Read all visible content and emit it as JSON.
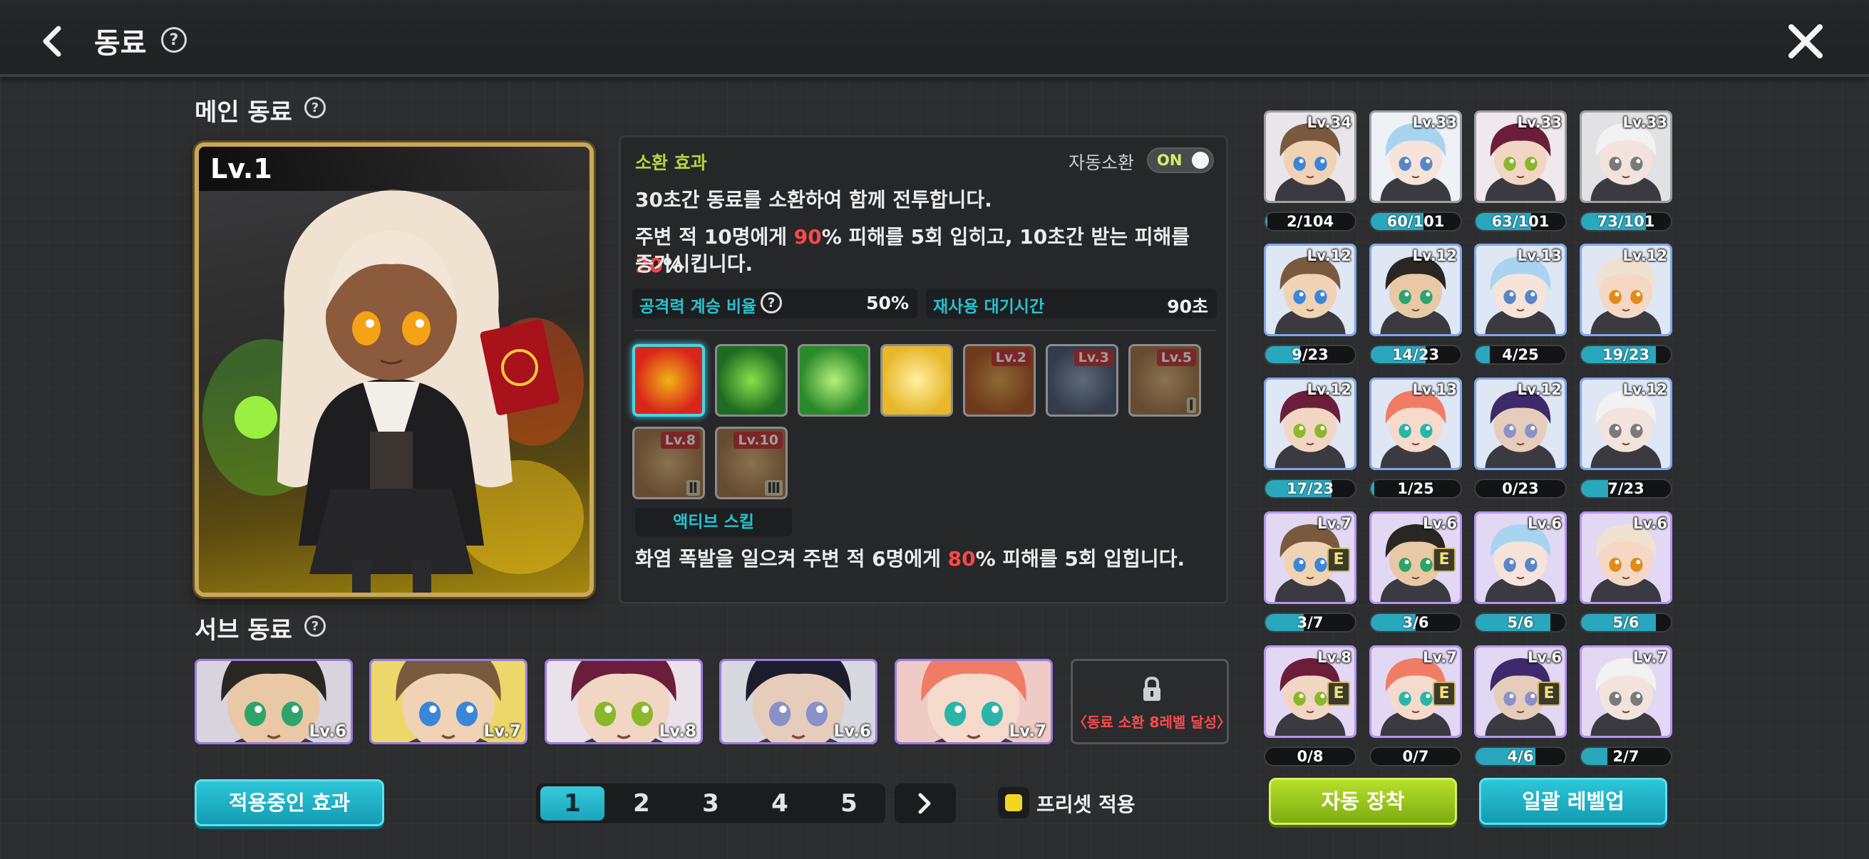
{
  "header": {
    "title": "동료",
    "help_glyph": "?"
  },
  "main_section": {
    "title": "메인 동료",
    "help_glyph": "?",
    "card_level": "Lv.1"
  },
  "skill": {
    "summon_label": "소환 효과",
    "auto_summon_label": "자동소환",
    "auto_summon_state": "ON",
    "desc1": "30초간 동료를 소환하여 함께 전투합니다.",
    "desc2": {
      "a": "주변 적 10명에게 ",
      "v1": "90",
      "b": "% 피해를 5회 입히고, 10초간 받는 피해를 ",
      "v2": "20",
      "c": "%"
    },
    "desc3": "증가시킵니다.",
    "attack_ratio_label": "공격력 계승 비율",
    "attack_ratio_value": "50%",
    "cooldown_label": "재사용 대기시간",
    "cooldown_value": "90초",
    "icons": [
      {
        "name": "skill-fire-burst-icon",
        "level": "",
        "tier": "",
        "selected": true,
        "locked": false,
        "c1": "#d8261a",
        "c2": "#f2b316"
      },
      {
        "name": "skill-green-flame-icon",
        "level": "",
        "tier": "",
        "selected": false,
        "locked": false,
        "c1": "#1e6b22",
        "c2": "#8ae04a"
      },
      {
        "name": "skill-green-sigil-icon",
        "level": "",
        "tier": "",
        "selected": false,
        "locked": false,
        "c1": "#2a8a2a",
        "c2": "#b7f07a"
      },
      {
        "name": "skill-golden-summon-icon",
        "level": "",
        "tier": "",
        "selected": false,
        "locked": false,
        "c1": "#e8b82c",
        "c2": "#fff0a0"
      },
      {
        "name": "skill-fire-wall-icon",
        "level": "Lv.2",
        "tier": "",
        "selected": false,
        "locked": true,
        "c1": "#a84a14",
        "c2": "#e0a040"
      },
      {
        "name": "skill-stance-icon",
        "level": "Lv.3",
        "tier": "",
        "selected": false,
        "locked": true,
        "c1": "#3e4e6a",
        "c2": "#8aa0c0"
      },
      {
        "name": "skill-passive-one-icon",
        "level": "Lv.5",
        "tier": "Ⅰ",
        "selected": false,
        "locked": true,
        "c1": "#9a6a3a",
        "c2": "#d8b070"
      },
      {
        "name": "skill-passive-two-icon",
        "level": "Lv.8",
        "tier": "Ⅱ",
        "selected": false,
        "locked": true,
        "c1": "#9a6a3a",
        "c2": "#d8b070"
      },
      {
        "name": "skill-passive-three-icon",
        "level": "Lv.10",
        "tier": "Ⅲ",
        "selected": false,
        "locked": true,
        "c1": "#9a6a3a",
        "c2": "#d8b070"
      }
    ],
    "active_label": "액티브 스킬",
    "active_desc": {
      "a": "화염 폭발을 일으켜 주변 적 6명에게 ",
      "v": "80",
      "b": "% 피해를 5회 입힙니다."
    }
  },
  "sub_section": {
    "title": "서브 동료",
    "help_glyph": "?",
    "slots": [
      {
        "level": "Lv.6",
        "hair": "#2a2622",
        "skin": "#e9c8a6",
        "eye": "#2ea468",
        "bg": "#d8d4de"
      },
      {
        "level": "Lv.7",
        "hair": "#7a5a3e",
        "skin": "#f0d2b4",
        "eye": "#3a86d8",
        "bg": "#ecd76a"
      },
      {
        "level": "Lv.8",
        "hair": "#6b1e3a",
        "skin": "#f2d6c4",
        "eye": "#8ab82a",
        "bg": "#e9e2ea"
      },
      {
        "level": "Lv.6",
        "hair": "#1c1c2c",
        "skin": "#e6cdbb",
        "eye": "#8a90c8",
        "bg": "#d8d8e0"
      },
      {
        "level": "Lv.7",
        "hair": "#f07c66",
        "skin": "#f6dacb",
        "eye": "#2ab5a8",
        "bg": "#eecbc4"
      }
    ],
    "locked_text": "〈동료 소환 8레벨 달성〉"
  },
  "controls": {
    "applied_effect_btn": "적용중인 효과",
    "pages": [
      "1",
      "2",
      "3",
      "4",
      "5"
    ],
    "active_page": "1",
    "preset_label": "프리셋 적용",
    "auto_equip_btn": "자동 장착",
    "bulk_levelup_btn": "일괄 레벨업"
  },
  "roster": [
    {
      "level": "Lv.34",
      "count": "2/104",
      "progress": 0.02,
      "frame": "gray",
      "badge": "",
      "hair": "#7a5a3e",
      "skin": "#f0d2b4",
      "eye": "#3a86d8",
      "bg": "#e8e6ea"
    },
    {
      "level": "Lv.33",
      "count": "60/101",
      "progress": 0.59,
      "frame": "gray",
      "badge": "",
      "hair": "#a9d4f0",
      "skin": "#f6e4da",
      "eye": "#5a86c8",
      "bg": "#eef2f6"
    },
    {
      "level": "Lv.33",
      "count": "63/101",
      "progress": 0.62,
      "frame": "gray",
      "badge": "",
      "hair": "#6b1e3a",
      "skin": "#f2d6c4",
      "eye": "#8ab82a",
      "bg": "#efe8ec"
    },
    {
      "level": "Lv.33",
      "count": "73/101",
      "progress": 0.72,
      "frame": "gray",
      "badge": "",
      "hair": "#f2f2f2",
      "skin": "#f2e4dc",
      "eye": "#7a7a7a",
      "bg": "#e2e2e4"
    },
    {
      "level": "Lv.12",
      "count": "9/23",
      "progress": 0.39,
      "frame": "blue",
      "badge": "",
      "hair": "#7a5a3e",
      "skin": "#f0d2b4",
      "eye": "#3a86d8",
      "bg": "#dfe6f4"
    },
    {
      "level": "Lv.12",
      "count": "14/23",
      "progress": 0.61,
      "frame": "blue",
      "badge": "",
      "hair": "#2a2622",
      "skin": "#e9c8a6",
      "eye": "#2ea468",
      "bg": "#dfe6f4"
    },
    {
      "level": "Lv.13",
      "count": "4/25",
      "progress": 0.16,
      "frame": "blue",
      "badge": "",
      "hair": "#a9d4f0",
      "skin": "#f6e4da",
      "eye": "#5a86c8",
      "bg": "#dfe6f4"
    },
    {
      "level": "Lv.12",
      "count": "19/23",
      "progress": 0.83,
      "frame": "blue",
      "badge": "",
      "hair": "#efe2d0",
      "skin": "#f4d8c4",
      "eye": "#e28a1a",
      "bg": "#dfe6f4"
    },
    {
      "level": "Lv.12",
      "count": "17/23",
      "progress": 0.74,
      "frame": "blue",
      "badge": "",
      "hair": "#6b1e3a",
      "skin": "#f2d6c4",
      "eye": "#8ab82a",
      "bg": "#dfe6f4"
    },
    {
      "level": "Lv.13",
      "count": "1/25",
      "progress": 0.04,
      "frame": "blue",
      "badge": "",
      "hair": "#f07c66",
      "skin": "#f6dacb",
      "eye": "#2ab5a8",
      "bg": "#dfe6f4"
    },
    {
      "level": "Lv.12",
      "count": "0/23",
      "progress": 0.0,
      "frame": "blue",
      "badge": "",
      "hair": "#3c2a6a",
      "skin": "#e6cdbb",
      "eye": "#8a90c8",
      "bg": "#dfe6f4"
    },
    {
      "level": "Lv.12",
      "count": "7/23",
      "progress": 0.3,
      "frame": "blue",
      "badge": "",
      "hair": "#f2f2f2",
      "skin": "#f2e4dc",
      "eye": "#7a7a7a",
      "bg": "#dfe6f4"
    },
    {
      "level": "Lv.7",
      "count": "3/7",
      "progress": 0.43,
      "frame": "purple",
      "badge": "E",
      "hair": "#7a5a3e",
      "skin": "#f0d2b4",
      "eye": "#3a86d8",
      "bg": "#e2d8f4"
    },
    {
      "level": "Lv.6",
      "count": "3/6",
      "progress": 0.5,
      "frame": "purple",
      "badge": "E",
      "hair": "#2a2622",
      "skin": "#e9c8a6",
      "eye": "#2ea468",
      "bg": "#e2d8f4"
    },
    {
      "level": "Lv.6",
      "count": "5/6",
      "progress": 0.83,
      "frame": "purple",
      "badge": "",
      "hair": "#a9d4f0",
      "skin": "#f6e4da",
      "eye": "#5a86c8",
      "bg": "#e2d8f4"
    },
    {
      "level": "Lv.6",
      "count": "5/6",
      "progress": 0.83,
      "frame": "purple",
      "badge": "",
      "hair": "#efe2d0",
      "skin": "#f4d8c4",
      "eye": "#e28a1a",
      "bg": "#e2d8f4"
    },
    {
      "level": "Lv.8",
      "count": "0/8",
      "progress": 0.0,
      "frame": "purple",
      "badge": "E",
      "hair": "#6b1e3a",
      "skin": "#f2d6c4",
      "eye": "#8ab82a",
      "bg": "#e2d8f4"
    },
    {
      "level": "Lv.7",
      "count": "0/7",
      "progress": 0.0,
      "frame": "purple",
      "badge": "E",
      "hair": "#f07c66",
      "skin": "#f6dacb",
      "eye": "#2ab5a8",
      "bg": "#e2d8f4"
    },
    {
      "level": "Lv.6",
      "count": "4/6",
      "progress": 0.67,
      "frame": "purple",
      "badge": "E",
      "hair": "#3c2a6a",
      "skin": "#e6cdbb",
      "eye": "#8a90c8",
      "bg": "#e2d8f4"
    },
    {
      "level": "Lv.7",
      "count": "2/7",
      "progress": 0.29,
      "frame": "purple",
      "badge": "",
      "hair": "#f2f2f2",
      "skin": "#f2e4dc",
      "eye": "#7a7a7a",
      "bg": "#e2d8f4"
    }
  ]
}
